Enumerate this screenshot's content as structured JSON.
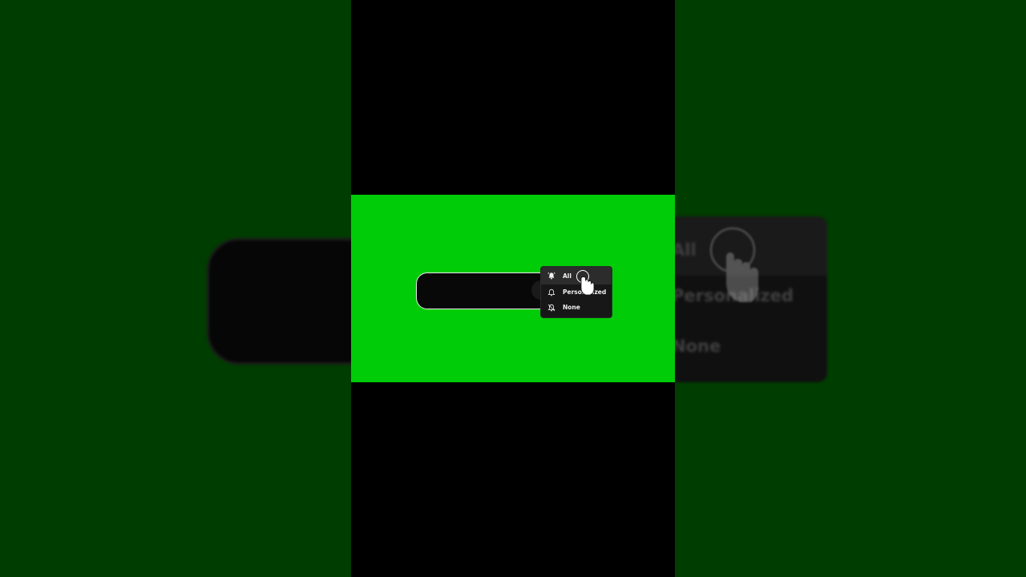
{
  "notification_menu": {
    "items": [
      {
        "label": "All",
        "icon": "bell-ringing-icon",
        "active": true
      },
      {
        "label": "Personalized",
        "icon": "bell-icon",
        "active": false
      },
      {
        "label": "None",
        "icon": "bell-off-icon",
        "active": false
      }
    ]
  },
  "backdrop_menu": {
    "items": [
      {
        "label": "All"
      },
      {
        "label": "Personalized"
      },
      {
        "label": "None"
      }
    ]
  },
  "colors": {
    "green_screen": "#00cc07",
    "backdrop_green": "#003d00",
    "menu_bg": "#171717",
    "menu_active_bg": "#2c2c2c",
    "text": "#f0f0f0"
  }
}
